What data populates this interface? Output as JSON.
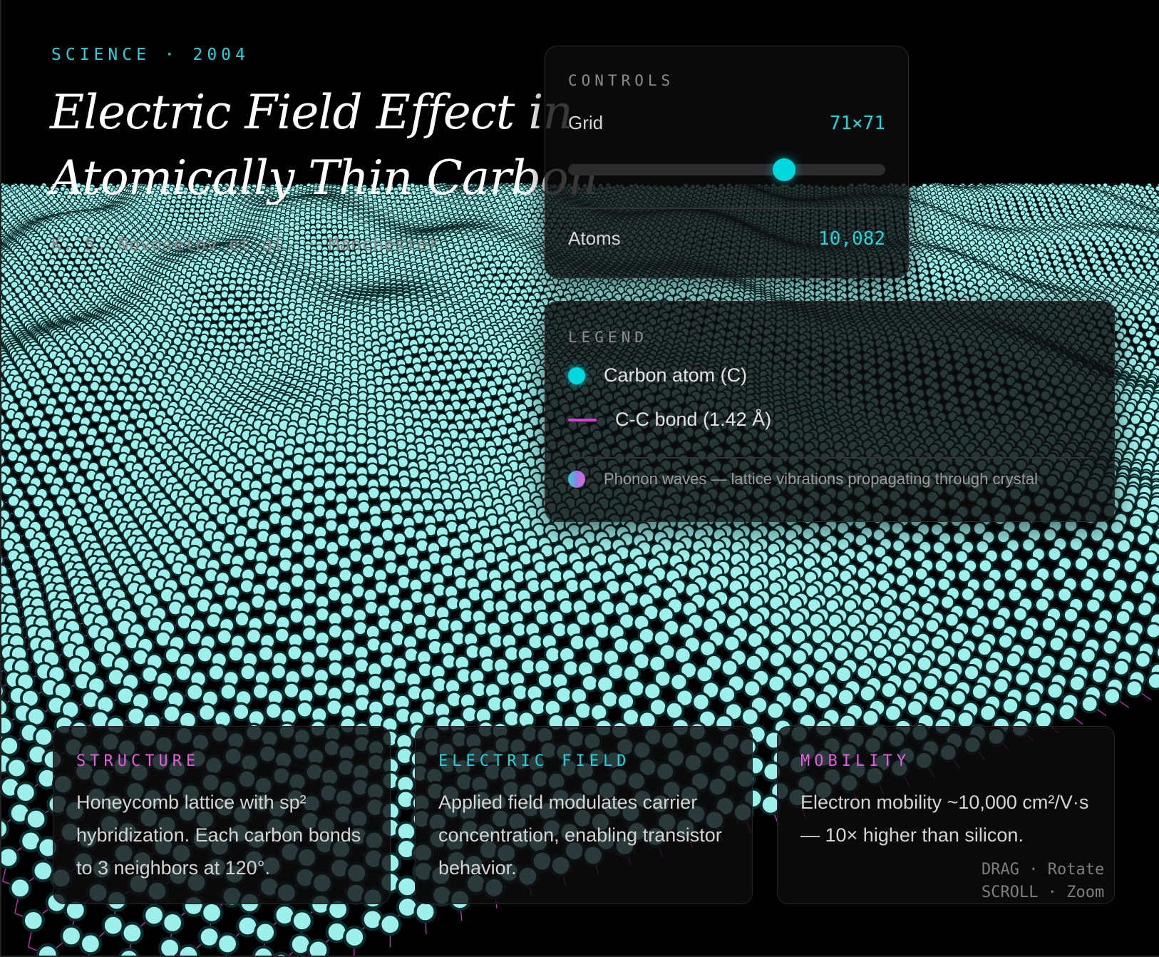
{
  "header": {
    "eyebrow": "SCIENCE · 2004",
    "title_line1": "Electric Field Effect in",
    "title_line2": "Atomically Thin Carbon",
    "authors": "K. S. Novoselov et al. · Manchester"
  },
  "controls": {
    "label": "CONTROLS",
    "grid_label": "Grid",
    "grid_value": "71×71",
    "grid_slider_fraction": 0.68,
    "atoms_label": "Atoms",
    "atoms_value": "10,082"
  },
  "legend": {
    "label": "LEGEND",
    "items": [
      {
        "text": "Carbon atom (C)",
        "icon": "atom-dot-icon"
      },
      {
        "text": "C-C bond (1.42 Å)",
        "icon": "bond-line-icon"
      },
      {
        "text": "Phonon waves — lattice vibrations propagating through crystal",
        "icon": "phonon-gradient-icon"
      }
    ]
  },
  "cards": [
    {
      "heading": "STRUCTURE",
      "body": "Honeycomb lattice with sp² hybridization. Each carbon bonds to 3 neighbors at 120°."
    },
    {
      "heading": "ELECTRIC FIELD",
      "body": "Applied field modulates carrier concentration, enabling transistor behavior."
    },
    {
      "heading": "MOBILITY",
      "body": "Electron mobility ~10,000 cm²/V·s — 10× higher than silicon."
    }
  ],
  "hints": {
    "drag": "DRAG · Rotate",
    "scroll": "SCROLL · Zoom"
  },
  "colors": {
    "atom": "#00d8e0",
    "bond": "#d93fd3",
    "accent_cyan": "#1fd6dc",
    "accent_magenta": "#e45ee0",
    "background": "#000000"
  }
}
